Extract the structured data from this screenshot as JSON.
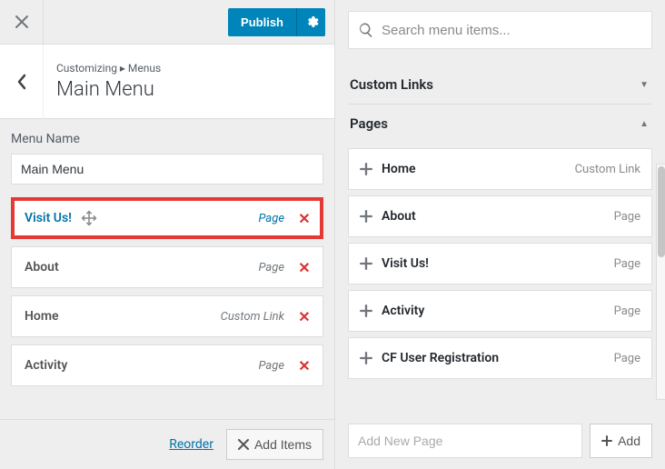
{
  "topbar": {
    "publish_label": "Publish"
  },
  "header": {
    "breadcrumb": "Customizing ▸ Menus",
    "title": "Main Menu"
  },
  "menu_name": {
    "label": "Menu Name",
    "value": "Main Menu"
  },
  "menu_items": [
    {
      "label": "Visit Us!",
      "type": "Page",
      "highlighted": true,
      "show_move": true
    },
    {
      "label": "About",
      "type": "Page",
      "highlighted": false,
      "show_move": false
    },
    {
      "label": "Home",
      "type": "Custom Link",
      "highlighted": false,
      "show_move": false
    },
    {
      "label": "Activity",
      "type": "Page",
      "highlighted": false,
      "show_move": false
    }
  ],
  "bottom": {
    "reorder_label": "Reorder",
    "add_items_label": "Add Items"
  },
  "search": {
    "placeholder": "Search menu items..."
  },
  "sections": {
    "custom_links_label": "Custom Links",
    "pages_label": "Pages"
  },
  "available_pages": [
    {
      "label": "Home",
      "type": "Custom Link"
    },
    {
      "label": "About",
      "type": "Page"
    },
    {
      "label": "Visit Us!",
      "type": "Page"
    },
    {
      "label": "Activity",
      "type": "Page"
    },
    {
      "label": "CF User Registration",
      "type": "Page"
    }
  ],
  "add_new": {
    "placeholder": "Add New Page",
    "button_label": "Add"
  }
}
